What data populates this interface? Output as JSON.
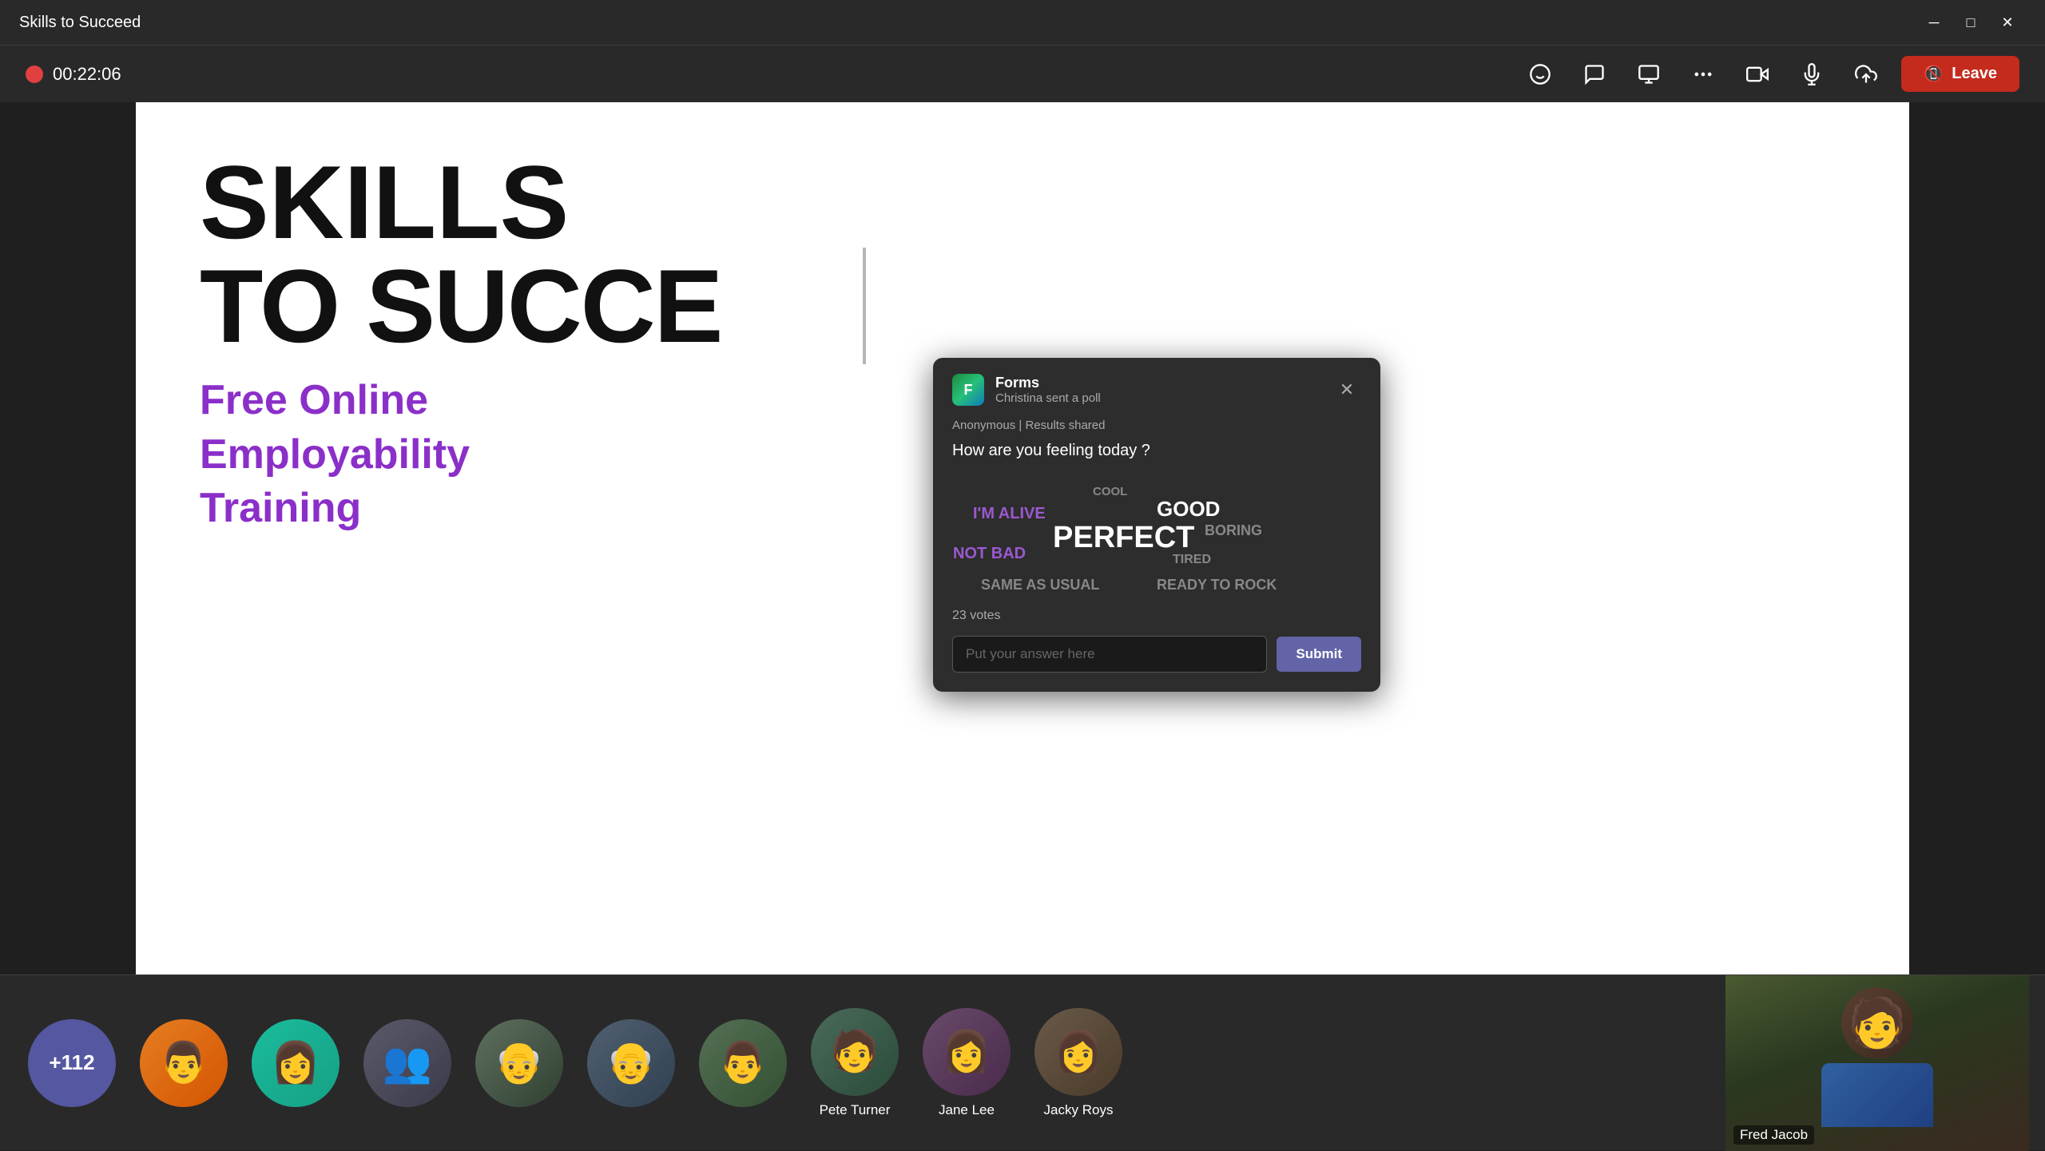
{
  "app": {
    "title": "Skills to Succeed"
  },
  "titleBar": {
    "minimize": "─",
    "maximize": "□",
    "close": "✕"
  },
  "meetingBar": {
    "recording_time": "00:22:06",
    "leave_label": "Leave"
  },
  "controls": [
    {
      "name": "reactions",
      "icon": "😊"
    },
    {
      "name": "chat",
      "icon": "💬"
    },
    {
      "name": "whiteboard",
      "icon": "📋"
    },
    {
      "name": "more",
      "icon": "•••"
    },
    {
      "name": "camera",
      "icon": "📹"
    },
    {
      "name": "mic",
      "icon": "🎤"
    },
    {
      "name": "share",
      "icon": "↑"
    }
  ],
  "slide": {
    "title_line1": "SKILLS",
    "title_line2": "TO SUCCE",
    "subtitle_line1": "Free Online",
    "subtitle_line2": "Employability",
    "subtitle_line3": "Training"
  },
  "poll": {
    "app_name": "Forms",
    "sender": "Christina sent a poll",
    "meta": "Anonymous | Results shared",
    "question": "How are you feeling today ?",
    "words": [
      {
        "text": "I'M ALIVE",
        "style": "purple medium"
      },
      {
        "text": "COOL",
        "style": "gray small"
      },
      {
        "text": "GOOD",
        "style": "white medium-large"
      },
      {
        "text": "NOT BAD",
        "style": "purple medium"
      },
      {
        "text": "PERFECT",
        "style": "white large"
      },
      {
        "text": "BORING",
        "style": "gray medium"
      },
      {
        "text": "Tired",
        "style": "gray small"
      },
      {
        "text": "SAME AS USUAL",
        "style": "gray medium"
      },
      {
        "text": "READY TO ROCK",
        "style": "gray medium"
      }
    ],
    "votes": "23 votes",
    "input_placeholder": "Put your answer here",
    "submit_label": "Submit"
  },
  "participants": [
    {
      "name": "",
      "type": "more",
      "count": "+112"
    },
    {
      "name": "",
      "type": "photo",
      "color": "av-orange",
      "emoji": "👨"
    },
    {
      "name": "",
      "type": "photo",
      "color": "av-teal",
      "emoji": "👩"
    },
    {
      "name": "",
      "type": "photo",
      "color": "av-gray",
      "emoji": "👥"
    },
    {
      "name": "",
      "type": "photo",
      "color": "av-blue",
      "emoji": "👴"
    },
    {
      "name": "",
      "type": "photo",
      "color": "av-purple",
      "emoji": "👴"
    },
    {
      "name": "",
      "type": "photo",
      "color": "av-red",
      "emoji": "👨"
    },
    {
      "name": "Pete Turner",
      "type": "photo",
      "color": "av-gray",
      "emoji": "👦"
    },
    {
      "name": "Jane Lee",
      "type": "photo",
      "color": "av-teal",
      "emoji": "👩"
    },
    {
      "name": "Jacky Roys",
      "type": "photo",
      "color": "av-orange",
      "emoji": "👩"
    },
    {
      "name": "Fred Jacob",
      "type": "video",
      "color": "av-blue",
      "emoji": "🧑"
    }
  ]
}
